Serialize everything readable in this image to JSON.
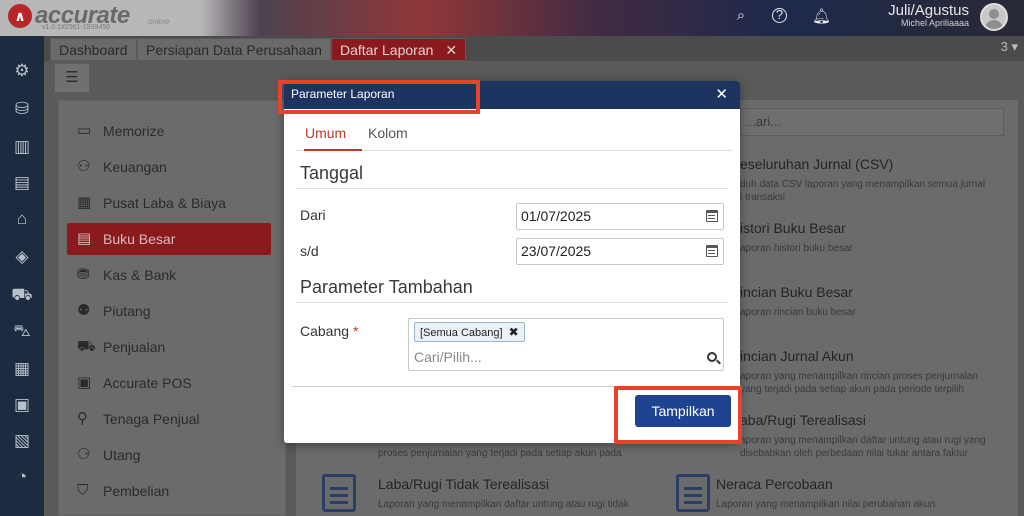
{
  "app": {
    "logo_text": "accurate",
    "logo_sub": "online",
    "version": "v1.0.1#2961-1939456"
  },
  "header": {
    "period": "Juli/Agustus",
    "user": "Michel Apriliaaaa"
  },
  "tabs": [
    {
      "label": "Dashboard"
    },
    {
      "label": "Persiapan Data Perusahaan"
    },
    {
      "label": "Daftar Laporan"
    }
  ],
  "tab_count": "3",
  "menu": [
    {
      "label": "Memorize"
    },
    {
      "label": "Keuangan"
    },
    {
      "label": "Pusat Laba & Biaya"
    },
    {
      "label": "Buku Besar"
    },
    {
      "label": "Kas & Bank"
    },
    {
      "label": "Piutang"
    },
    {
      "label": "Penjualan"
    },
    {
      "label": "Accurate POS"
    },
    {
      "label": "Tenaga Penjual"
    },
    {
      "label": "Utang"
    },
    {
      "label": "Pembelian"
    }
  ],
  "report_search": {
    "placeholder": "...ari..."
  },
  "reports": [
    {
      "title": "eseluruhan Jurnal (CSV)",
      "desc1": "duh data CSV laporan yang menampilkan semua jurnal",
      "desc2": "i transaksi"
    },
    {
      "title": "istori Buku Besar",
      "desc1": "aporan histori buku besar",
      "desc2": ""
    },
    {
      "title": "incian Buku Besar",
      "desc1": "aporan rincian buku besar",
      "desc2": ""
    },
    {
      "title": "incian Jurnal Akun",
      "desc1": "aporan yang menampilkan rincian proses penjurnalan",
      "desc2": "yang terjadi pada setiap akun pada periode terpilih"
    },
    {
      "title": "aba/Rugi Terealisasi",
      "desc1": "aporan yang menampilkan daftar untung atau rugi yang",
      "desc2": "disebabkan oleh perbedaan nilai tukar antara faktur"
    },
    {
      "title": "Neraca Percobaan",
      "desc1": "Laporan yang menampilkan nilai perubahan akun",
      "desc2": ""
    }
  ],
  "bg_left_report": {
    "desc": "proses penjurnalan yang terjadi pada setiap akun pada",
    "title": "Laba/Rugi Tidak Terealisasi",
    "desc2": "Laporan yang menampilkan daftar untung atau rugi tidak"
  },
  "modal": {
    "title": "Parameter Laporan",
    "tab_general": "Umum",
    "tab_column": "Kolom",
    "section_date": "Tanggal",
    "label_from": "Dari",
    "value_from": "01/07/2025",
    "label_to": "s/d",
    "value_to": "23/07/2025",
    "section_extra": "Parameter Tambahan",
    "label_branch": "Cabang",
    "branch_chip": "[Semua Cabang]",
    "branch_placeholder": "Cari/Pilih...",
    "show_button": "Tampilkan"
  },
  "colors": {
    "header": "#1d3461",
    "primary_button": "#1e4390",
    "accent_red": "#c0392b",
    "highlight": "#e8432a"
  }
}
